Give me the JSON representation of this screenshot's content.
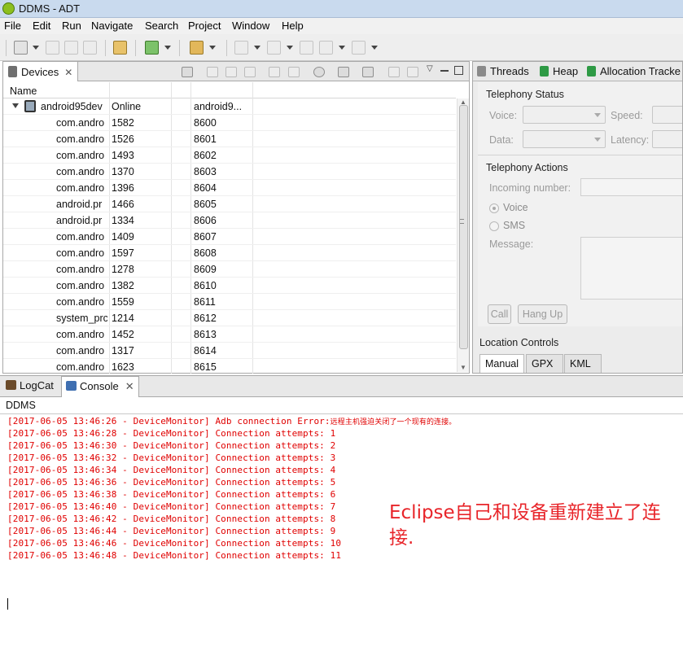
{
  "window": {
    "title": "DDMS - ADT"
  },
  "menu": [
    "File",
    "Edit",
    "Run",
    "Navigate",
    "Search",
    "Project",
    "Window",
    "Help"
  ],
  "devices_view": {
    "tab_label": "Devices",
    "columns": [
      "Name"
    ],
    "device": {
      "name": "android95dev",
      "status": "Online",
      "serial": "android9..."
    },
    "processes": [
      {
        "name": "com.andro",
        "pid": "1582",
        "port": "8600"
      },
      {
        "name": "com.andro",
        "pid": "1526",
        "port": "8601"
      },
      {
        "name": "com.andro",
        "pid": "1493",
        "port": "8602"
      },
      {
        "name": "com.andro",
        "pid": "1370",
        "port": "8603"
      },
      {
        "name": "com.andro",
        "pid": "1396",
        "port": "8604"
      },
      {
        "name": "android.pr",
        "pid": "1466",
        "port": "8605"
      },
      {
        "name": "android.pr",
        "pid": "1334",
        "port": "8606"
      },
      {
        "name": "com.andro",
        "pid": "1409",
        "port": "8607"
      },
      {
        "name": "com.andro",
        "pid": "1597",
        "port": "8608"
      },
      {
        "name": "com.andro",
        "pid": "1278",
        "port": "8609"
      },
      {
        "name": "com.andro",
        "pid": "1382",
        "port": "8610"
      },
      {
        "name": "com.andro",
        "pid": "1559",
        "port": "8611"
      },
      {
        "name": "system_prc",
        "pid": "1214",
        "port": "8612"
      },
      {
        "name": "com.andro",
        "pid": "1452",
        "port": "8613"
      },
      {
        "name": "com.andro",
        "pid": "1317",
        "port": "8614"
      },
      {
        "name": "com.andro",
        "pid": "1623",
        "port": "8615"
      }
    ]
  },
  "right_tabs": [
    "Threads",
    "Heap",
    "Allocation Tracke"
  ],
  "emulator_control": {
    "telephony_status": "Telephony Status",
    "voice_label": "Voice:",
    "speed_label": "Speed:",
    "data_label": "Data:",
    "latency_label": "Latency:",
    "telephony_actions": "Telephony Actions",
    "incoming_number_label": "Incoming number:",
    "voice_option": "Voice",
    "sms_option": "SMS",
    "message_label": "Message:",
    "call_button": "Call",
    "hang_up_button": "Hang Up",
    "location_controls": "Location Controls",
    "location_tabs": [
      "Manual",
      "GPX",
      "KML"
    ]
  },
  "bottom_tabs": [
    "LogCat",
    "Console"
  ],
  "console": {
    "name": "DDMS",
    "lines": [
      {
        "text": "[2017-06-05 13:46:26 - DeviceMonitor] Adb connection Error:",
        "zh": "远程主机强迫关闭了一个现有的连接。"
      },
      {
        "text": "[2017-06-05 13:46:28 - DeviceMonitor] Connection attempts: 1"
      },
      {
        "text": "[2017-06-05 13:46:30 - DeviceMonitor] Connection attempts: 2"
      },
      {
        "text": "[2017-06-05 13:46:32 - DeviceMonitor] Connection attempts: 3"
      },
      {
        "text": "[2017-06-05 13:46:34 - DeviceMonitor] Connection attempts: 4"
      },
      {
        "text": "[2017-06-05 13:46:36 - DeviceMonitor] Connection attempts: 5"
      },
      {
        "text": "[2017-06-05 13:46:38 - DeviceMonitor] Connection attempts: 6"
      },
      {
        "text": "[2017-06-05 13:46:40 - DeviceMonitor] Connection attempts: 7"
      },
      {
        "text": "[2017-06-05 13:46:42 - DeviceMonitor] Connection attempts: 8"
      },
      {
        "text": "[2017-06-05 13:46:44 - DeviceMonitor] Connection attempts: 9"
      },
      {
        "text": "[2017-06-05 13:46:46 - DeviceMonitor] Connection attempts: 10"
      },
      {
        "text": "[2017-06-05 13:46:48 - DeviceMonitor] Connection attempts: 11"
      }
    ]
  },
  "annotation": "Eclipse自己和设备重新建立了连接."
}
